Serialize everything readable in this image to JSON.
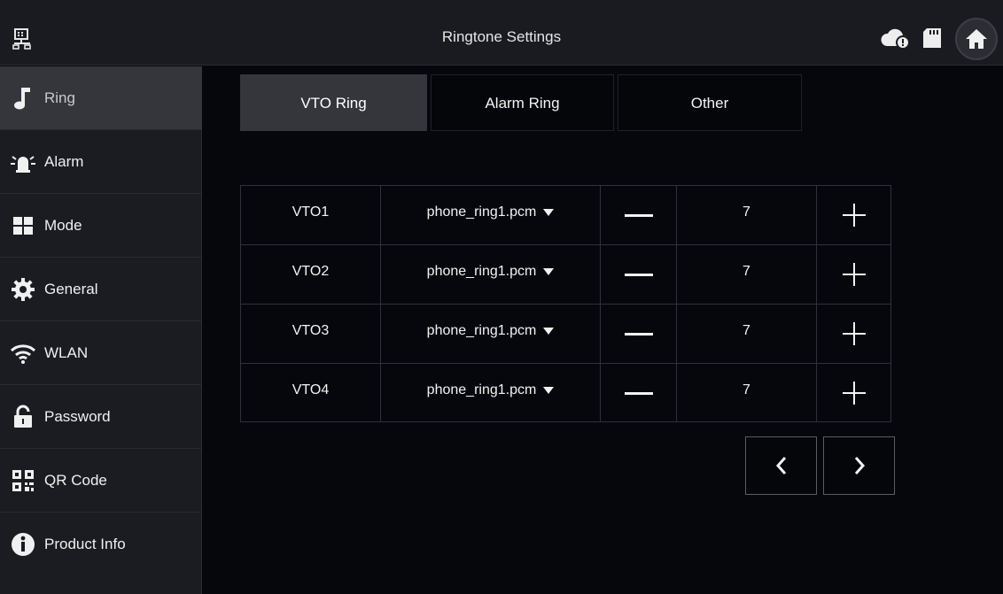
{
  "header": {
    "title": "Ringtone Settings",
    "icons": [
      "network-icon",
      "cloud-icon",
      "sd-card-icon",
      "home-icon"
    ]
  },
  "sidebar": {
    "items": [
      {
        "label": "Ring",
        "icon": "music-note-icon",
        "active": true
      },
      {
        "label": "Alarm",
        "icon": "alarm-light-icon",
        "active": false
      },
      {
        "label": "Mode",
        "icon": "mode-grid-icon",
        "active": false
      },
      {
        "label": "General",
        "icon": "gear-icon",
        "active": false
      },
      {
        "label": "WLAN",
        "icon": "wifi-icon",
        "active": false
      },
      {
        "label": "Password",
        "icon": "lock-icon",
        "active": false
      },
      {
        "label": "QR Code",
        "icon": "qr-code-icon",
        "active": false
      },
      {
        "label": "Product Info",
        "icon": "info-icon",
        "active": false
      }
    ]
  },
  "tabs": [
    {
      "label": "VTO Ring",
      "active": true
    },
    {
      "label": "Alarm Ring",
      "active": false
    },
    {
      "label": "Other",
      "active": false
    }
  ],
  "rings": [
    {
      "name": "VTO1",
      "ringtone": "phone_ring1.pcm",
      "volume": "7"
    },
    {
      "name": "VTO2",
      "ringtone": "phone_ring1.pcm",
      "volume": "7"
    },
    {
      "name": "VTO3",
      "ringtone": "phone_ring1.pcm",
      "volume": "7"
    },
    {
      "name": "VTO4",
      "ringtone": "phone_ring1.pcm",
      "volume": "7"
    }
  ],
  "pager": {
    "prev": "previous-page",
    "next": "next-page"
  },
  "colors": {
    "background": "#06070c",
    "panel": "#1b1c21",
    "active": "#34363c",
    "text": "#f2f2f2"
  }
}
